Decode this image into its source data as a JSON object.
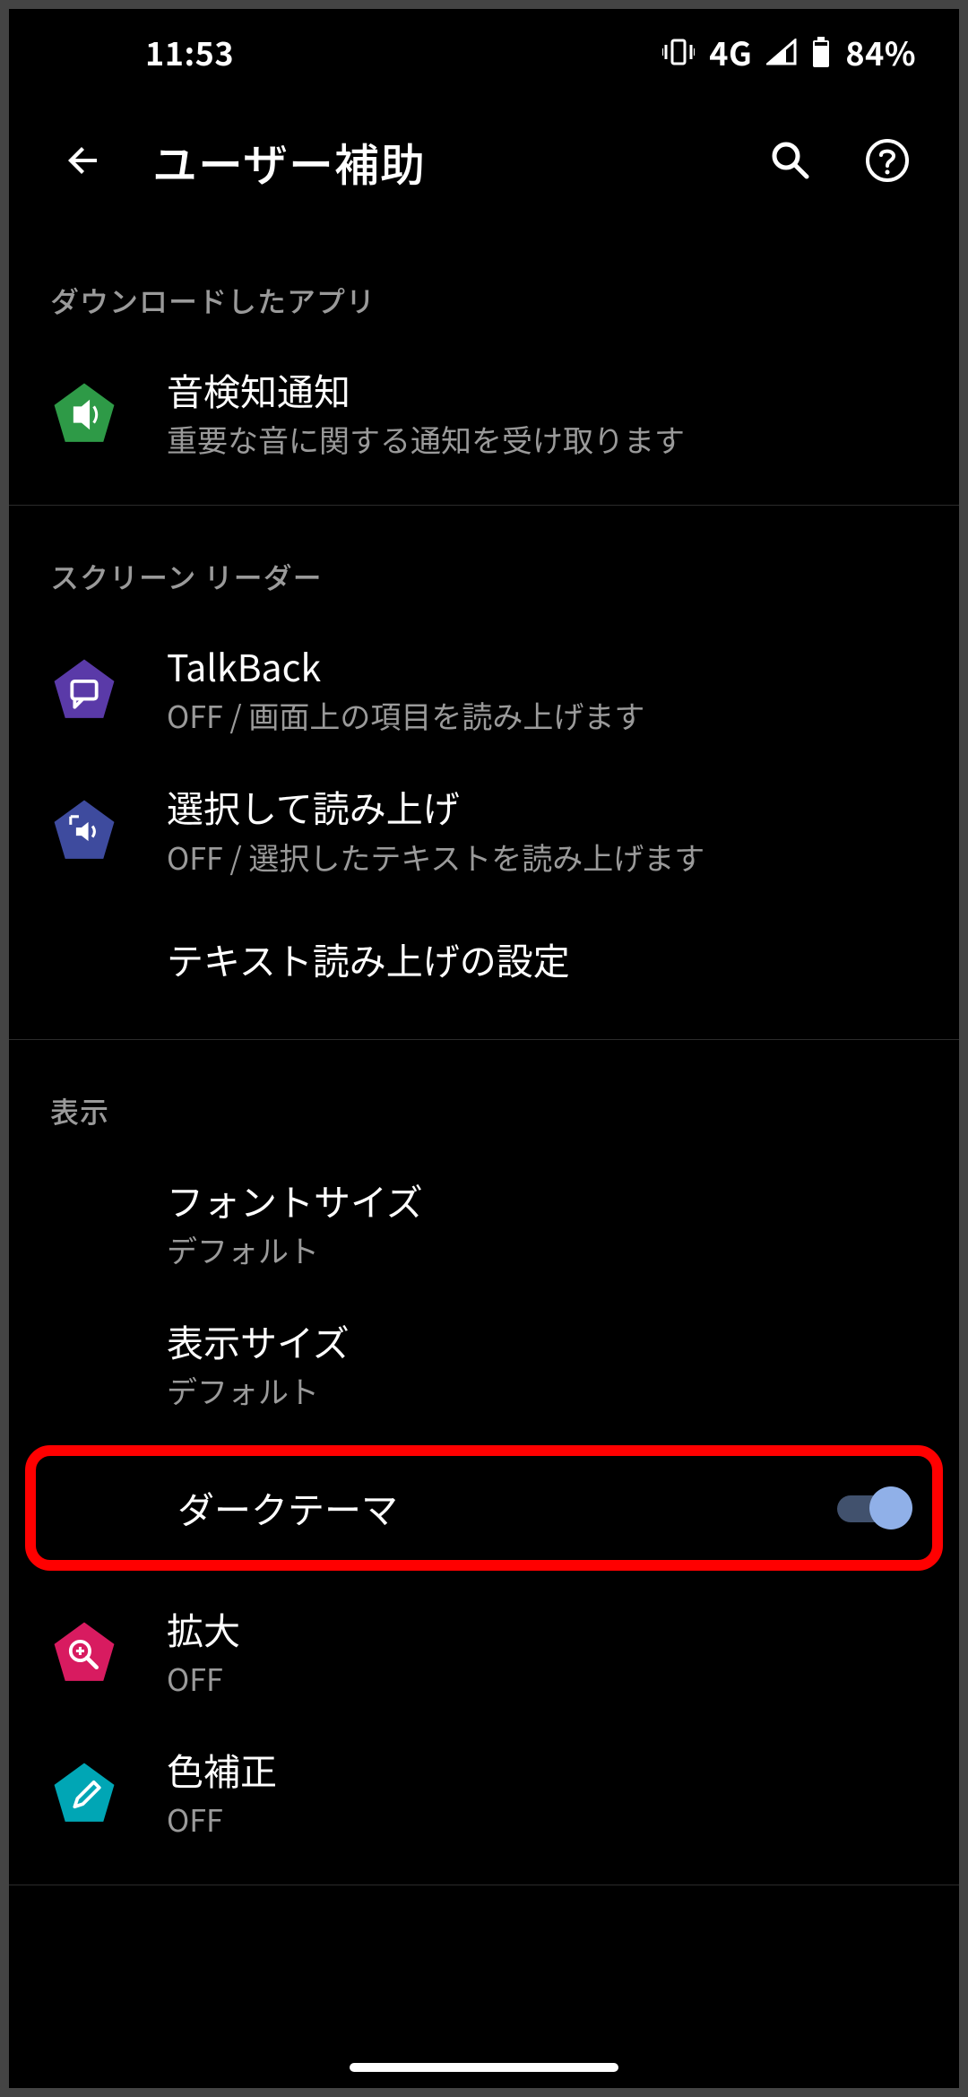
{
  "status": {
    "time": "11:53",
    "network": "4G",
    "battery": "84%"
  },
  "header": {
    "title": "ユーザー補助"
  },
  "sections": {
    "downloaded": {
      "label": "ダウンロードしたアプリ",
      "sound_notification": {
        "title": "音検知通知",
        "subtitle": "重要な音に関する通知を受け取ります"
      }
    },
    "screen_reader": {
      "label": "スクリーン リーダー",
      "talkback": {
        "title": "TalkBack",
        "subtitle": "OFF / 画面上の項目を読み上げます"
      },
      "select_to_speak": {
        "title": "選択して読み上げ",
        "subtitle": "OFF / 選択したテキストを読み上げます"
      },
      "tts": {
        "title": "テキスト読み上げの設定"
      }
    },
    "display": {
      "label": "表示",
      "font_size": {
        "title": "フォントサイズ",
        "subtitle": "デフォルト"
      },
      "display_size": {
        "title": "表示サイズ",
        "subtitle": "デフォルト"
      },
      "dark_theme": {
        "title": "ダークテーマ",
        "enabled": true
      },
      "magnification": {
        "title": "拡大",
        "subtitle": "OFF"
      },
      "color_correction": {
        "title": "色補正",
        "subtitle": "OFF"
      }
    }
  },
  "colors": {
    "icon_green": "#2e9a47",
    "icon_purple": "#5a3aa8",
    "icon_indigo": "#3e4b9e",
    "icon_magenta": "#d81b60",
    "icon_teal": "#00a6b5",
    "switch_thumb": "#90b0e8",
    "switch_track": "#41516d",
    "highlight_border": "#ff0000"
  }
}
